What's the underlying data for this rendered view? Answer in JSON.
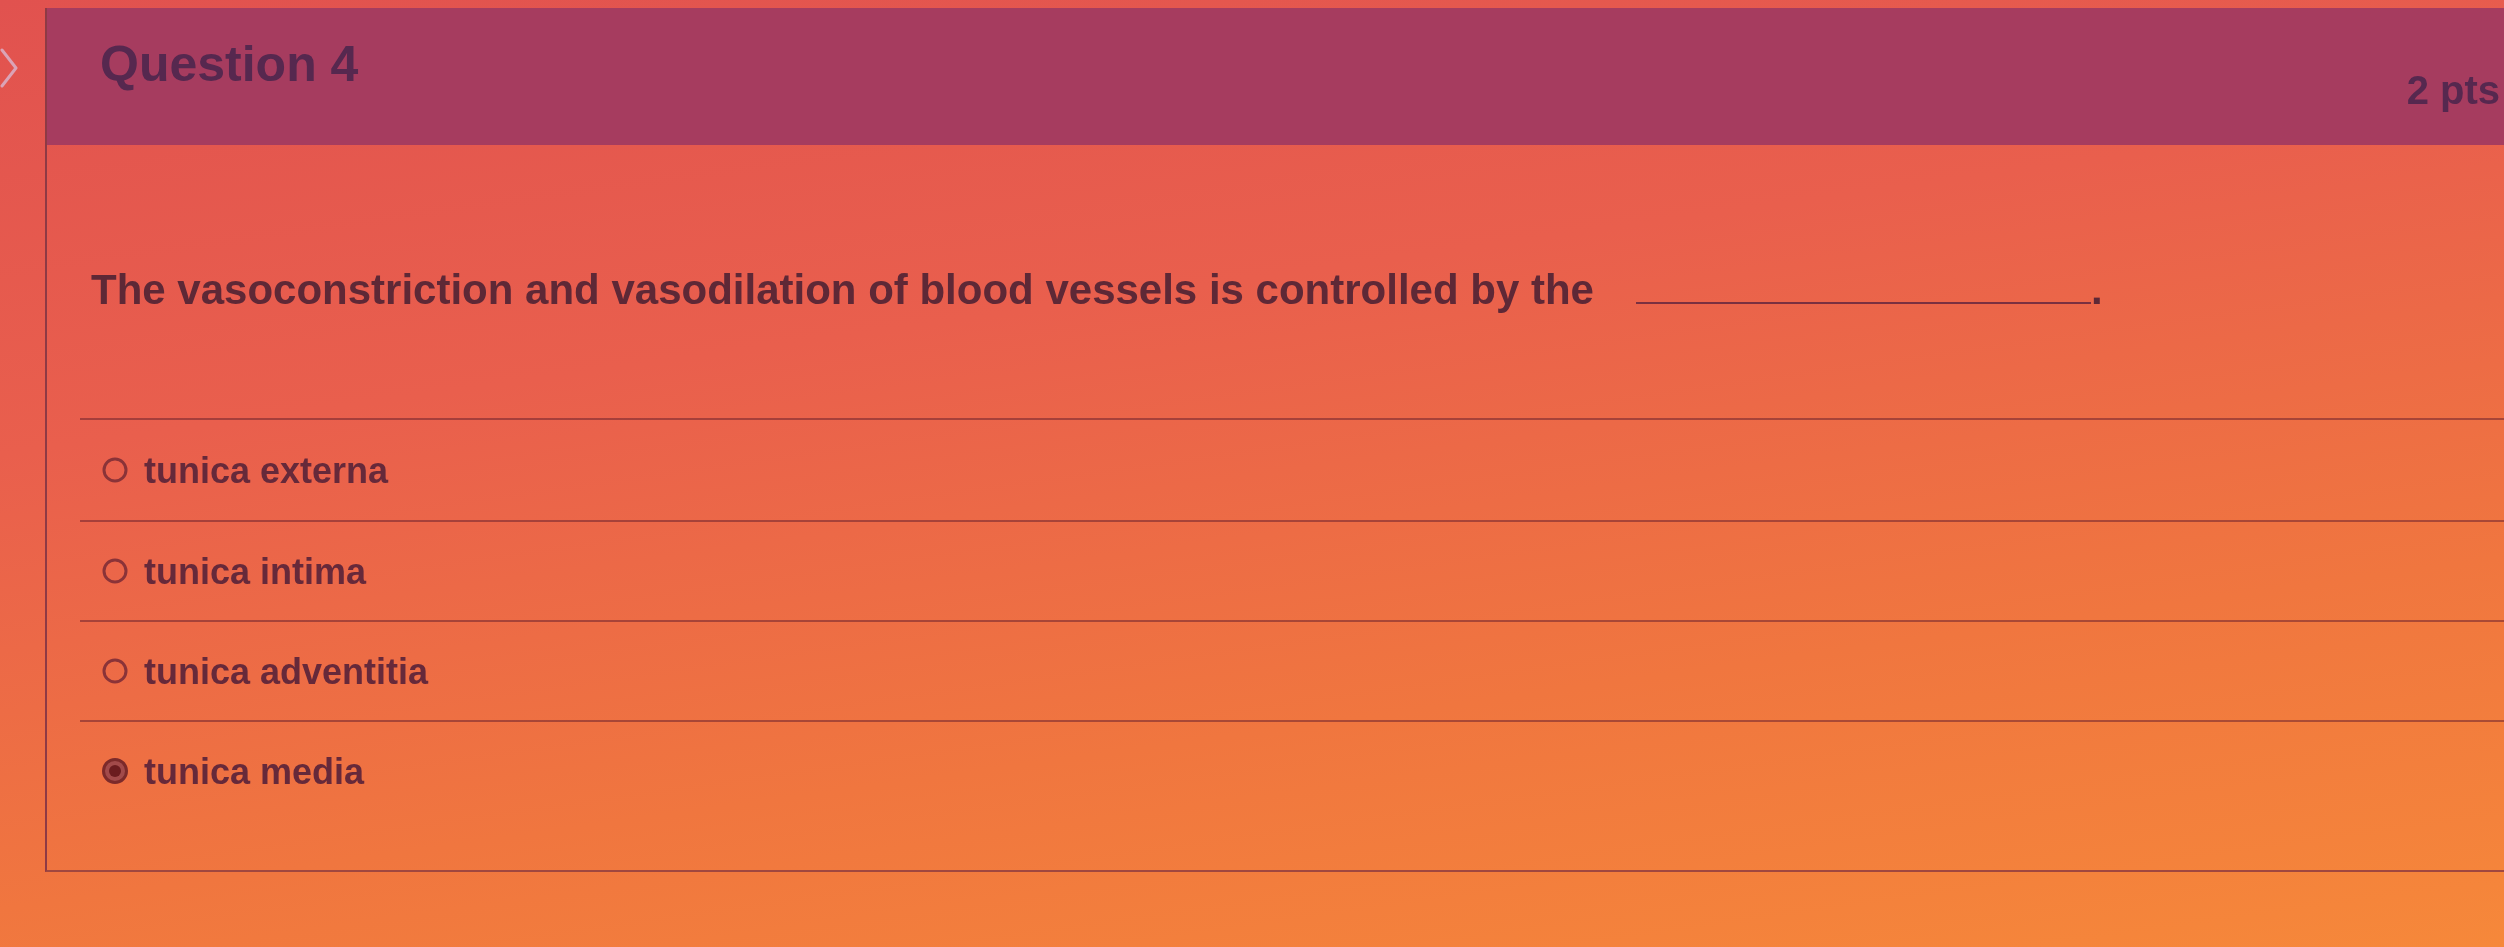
{
  "question": {
    "title": "Question 4",
    "points": "2 pts",
    "prompt": "The vasoconstriction and vasodilation of blood vessels is controlled by the",
    "after_blank": "."
  },
  "answers": [
    {
      "label": "tunica externa",
      "selected": false
    },
    {
      "label": "tunica intima",
      "selected": false
    },
    {
      "label": "tunica adventitia",
      "selected": false
    },
    {
      "label": "tunica media",
      "selected": true
    }
  ]
}
